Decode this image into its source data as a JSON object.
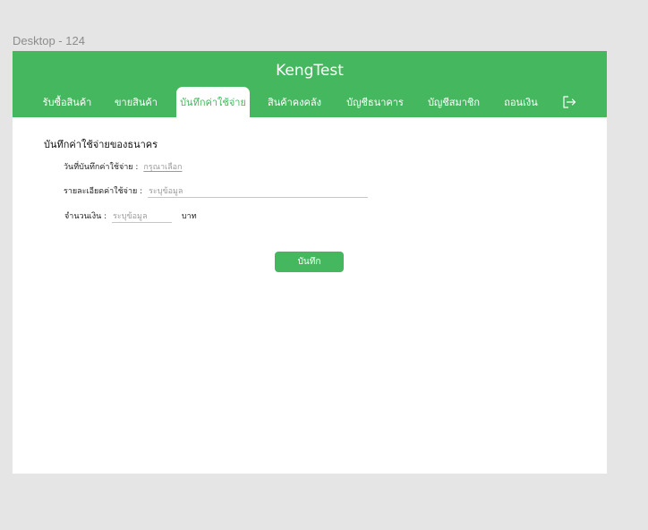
{
  "frame_label": "Desktop - 124",
  "header": {
    "title": "KengTest",
    "nav": [
      {
        "label": "รับซื้อสินค้า"
      },
      {
        "label": "ขายสินค้า"
      },
      {
        "label": "บันทึกค่าใช้จ่าย",
        "active": true
      },
      {
        "label": "สินค้าคงคลัง"
      },
      {
        "label": "บัญชีธนาคาร"
      },
      {
        "label": "บัญชีสมาชิก"
      },
      {
        "label": "ถอนเงิน"
      }
    ],
    "logout_icon": "logout-icon"
  },
  "form": {
    "title": "บันทึกค่าใช้จ่ายของธนาคร",
    "date_label": "วันที่บันทึกค่าใช้จ่าย :",
    "date_value": "กรุณาเลือก",
    "detail_label": "รายละเอียดค่าใช้จ่าย :",
    "detail_placeholder": "ระบุข้อมูล",
    "amount_label": "จำนวนเงิน :",
    "amount_placeholder": "ระบุข้อมูล",
    "amount_unit": "บาท",
    "save_label": "บันทึก"
  },
  "colors": {
    "accent": "#45b75e",
    "canvas": "#e5e5e5",
    "placeholder": "#9a9a9a"
  }
}
